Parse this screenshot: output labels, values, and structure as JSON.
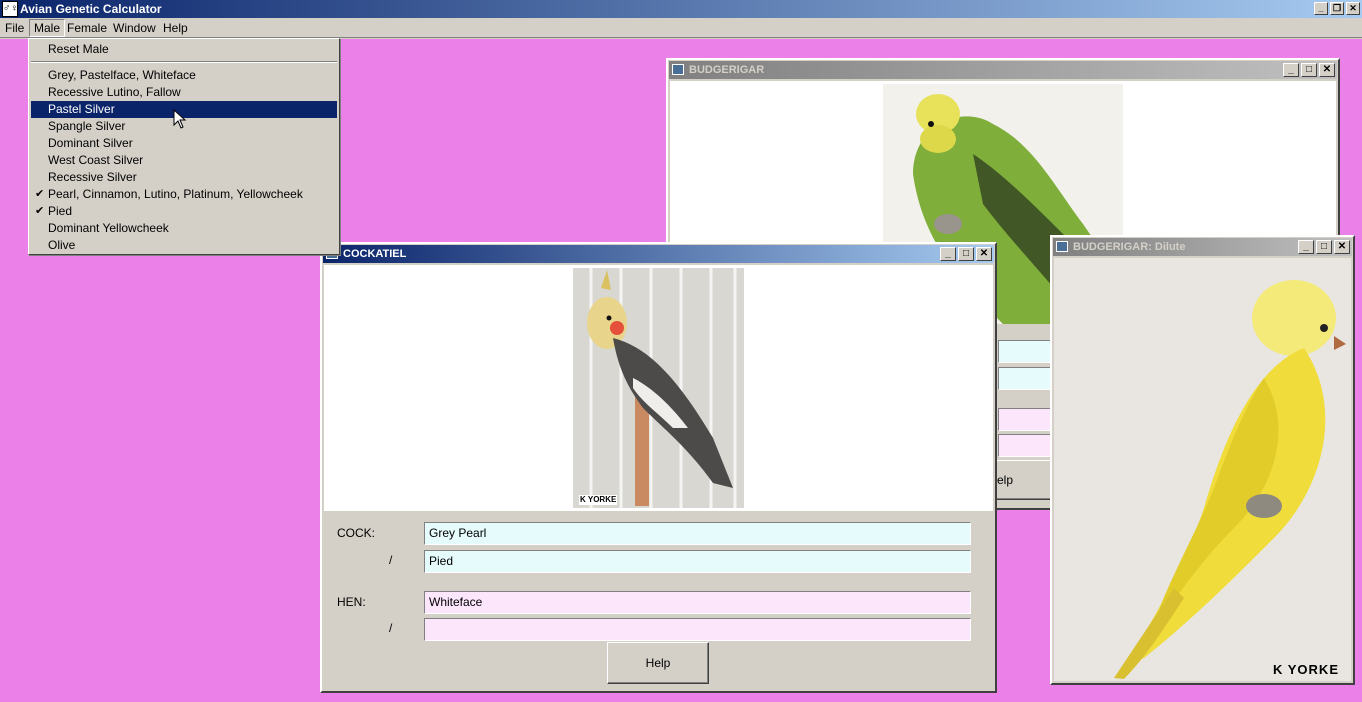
{
  "app": {
    "title": "Avian Genetic Calculator",
    "icon_glyph": "♂♀",
    "mdi_minimize": "_",
    "mdi_restore": "❐",
    "mdi_close": "✕"
  },
  "menubar": {
    "items": [
      "File",
      "Male",
      "Female",
      "Window",
      "Help"
    ]
  },
  "male_menu": {
    "reset_label": "Reset Male",
    "items": [
      {
        "label": "Grey, Pastelface, Whiteface",
        "checked": false
      },
      {
        "label": "Recessive Lutino, Fallow",
        "checked": false
      },
      {
        "label": "Pastel Silver",
        "checked": false,
        "highlighted": true
      },
      {
        "label": "Spangle Silver",
        "checked": false
      },
      {
        "label": "Dominant Silver",
        "checked": false
      },
      {
        "label": "West Coast Silver",
        "checked": false
      },
      {
        "label": "Recessive Silver",
        "checked": false
      },
      {
        "label": "Pearl, Cinnamon, Lutino, Platinum, Yellowcheek",
        "checked": true
      },
      {
        "label": "Pied",
        "checked": true
      },
      {
        "label": "Dominant Yellowcheek",
        "checked": false
      },
      {
        "label": "Olive",
        "checked": false
      }
    ],
    "check_glyph": "✔"
  },
  "windows": {
    "budgerigar": {
      "title": "BUDGERIGAR",
      "help_fragment": "elp"
    },
    "cockatiel": {
      "title": "COCKATIEL",
      "photo_credit": "K YORKE",
      "cock_label": "COCK:",
      "hen_label": "HEN:",
      "slash": "/",
      "cock_value_1": "Grey Pearl",
      "cock_value_2": "Pied",
      "hen_value_1": "Whiteface",
      "hen_value_2": "",
      "help_button": "Help"
    },
    "budgerigar_dilute": {
      "title": "BUDGERIGAR: Dilute",
      "photo_credit": "K YORKE"
    }
  },
  "colors": {
    "mdi_background": "#ea80e8",
    "cock_field": "#e6fcfc",
    "hen_field": "#fce6fc",
    "menu_highlight": "#0a246a"
  }
}
